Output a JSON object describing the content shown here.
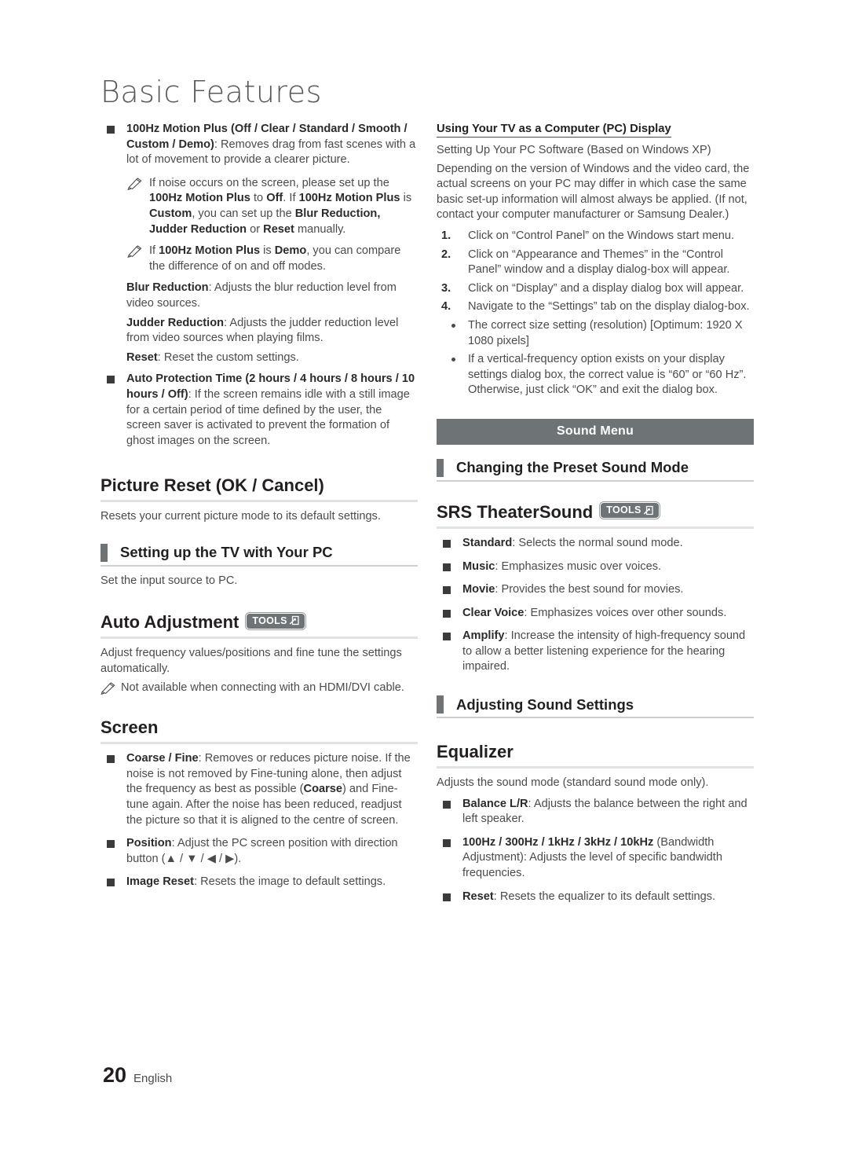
{
  "page": {
    "chapter_title": "Basic Features",
    "page_number": "20",
    "language": "English"
  },
  "icons": {
    "note": "pencil-note-icon",
    "tools": "tools-badge-icon",
    "bullet": "square-bullet-icon"
  },
  "colors": {
    "banner_bg": "#6e7375",
    "tab_marker": "#6e7375",
    "rule_main": "#e2e2e2",
    "rule_sub": "#cfcfcf",
    "body_text": "#4b4b4b",
    "heading_text": "#231f20"
  },
  "left_column": {
    "motion_plus_bullet": {
      "term": "100Hz Motion Plus (Off / Clear / Standard / Smooth / Custom / Demo)",
      "desc": ": Removes drag from fast scenes with a lot of movement to provide a clearer picture."
    },
    "notes": [
      {
        "parts": [
          {
            "t": "If noise occurs on the screen, please set up the ",
            "b": false
          },
          {
            "t": "100Hz Motion Plus",
            "b": true
          },
          {
            "t": " to ",
            "b": false
          },
          {
            "t": "Off",
            "b": true
          },
          {
            "t": ". If ",
            "b": false
          },
          {
            "t": "100Hz Motion Plus",
            "b": true
          },
          {
            "t": " is ",
            "b": false
          },
          {
            "t": "Custom",
            "b": true
          },
          {
            "t": ", you can set up the ",
            "b": false
          },
          {
            "t": "Blur Reduction, Judder Reduction",
            "b": true
          },
          {
            "t": " or ",
            "b": false
          },
          {
            "t": "Reset",
            "b": true
          },
          {
            "t": " manually.",
            "b": false
          }
        ]
      },
      {
        "parts": [
          {
            "t": "If ",
            "b": false
          },
          {
            "t": "100Hz Motion Plus",
            "b": true
          },
          {
            "t": " is ",
            "b": false
          },
          {
            "t": "Demo",
            "b": true
          },
          {
            "t": ", you can compare the difference of on and off modes.",
            "b": false
          }
        ]
      }
    ],
    "sub_paras": [
      {
        "term": "Blur Reduction",
        "desc": ": Adjusts the blur reduction level from video sources."
      },
      {
        "term": "Judder Reduction",
        "desc": ": Adjusts the judder reduction level from video sources when playing films."
      },
      {
        "term": "Reset",
        "desc": ": Reset the custom settings."
      }
    ],
    "auto_protection_bullet": {
      "term": "Auto Protection Time (2 hours / 4 hours / 8 hours / 10 hours / Off)",
      "desc": ": If the screen remains idle with a still image for a certain period of time defined by the user, the screen saver is activated to prevent the formation of ghost images on the screen."
    },
    "picture_reset": {
      "heading": "Picture Reset (OK / Cancel)",
      "body": "Resets your current picture mode to its default settings."
    },
    "setting_up_tv_pc": {
      "heading": "Setting up the TV with Your PC",
      "body": "Set the input source to PC."
    },
    "auto_adjustment": {
      "heading": "Auto Adjustment",
      "tools_label": "TOOLS",
      "body": "Adjust frequency values/positions and fine tune the settings automatically.",
      "note": "Not available when connecting with an HDMI/DVI cable."
    },
    "screen": {
      "heading": "Screen",
      "bullets": [
        {
          "parts": [
            {
              "t": "Coarse / Fine",
              "b": true
            },
            {
              "t": ": Removes or reduces picture noise. If the noise is not removed by Fine-tuning alone, then adjust the frequency as best as possible (",
              "b": false
            },
            {
              "t": "Coarse",
              "b": true
            },
            {
              "t": ") and Fine-tune again. After the noise has been reduced, readjust the picture so that it is aligned to the centre of screen.",
              "b": false
            }
          ]
        },
        {
          "parts": [
            {
              "t": "Position",
              "b": true
            },
            {
              "t": ": Adjust the PC screen position with direction button (▲ / ▼ / ◀ / ▶).",
              "b": false
            }
          ]
        },
        {
          "parts": [
            {
              "t": "Image Reset",
              "b": true
            },
            {
              "t": ": Resets the image to default settings.",
              "b": false
            }
          ]
        }
      ]
    }
  },
  "right_column": {
    "pc_display": {
      "heading": "Using Your TV as a Computer (PC) Display",
      "subtitle": "Setting Up Your PC Software (Based on Windows XP)",
      "intro": "Depending on the version of Windows and the video card, the actual screens on your PC may differ in which case the same basic set-up information will almost always be applied. (If not, contact your computer manufacturer or Samsung Dealer.)",
      "steps": [
        {
          "num": "1.",
          "text": "Click on “Control Panel” on the Windows start menu."
        },
        {
          "num": "2.",
          "text": "Click on “Appearance and Themes” in the “Control Panel” window and a display dialog-box will appear."
        },
        {
          "num": "3.",
          "text": "Click on “Display” and a display dialog box will appear."
        },
        {
          "num": "4.",
          "text": "Navigate to the “Settings” tab on the display dialog-box."
        }
      ],
      "dot_points": [
        "The correct size setting (resolution) [Optimum: 1920 X 1080 pixels]",
        "If a vertical-frequency option exists on your display settings dialog box, the correct value is “60” or “60 Hz”. Otherwise, just click “OK” and exit the dialog box."
      ]
    },
    "sound_menu_banner": "Sound Menu",
    "preset_sound_mode": {
      "heading": "Changing the Preset Sound Mode"
    },
    "srs_theatersound": {
      "heading": "SRS TheaterSound",
      "tools_label": "TOOLS",
      "bullets": [
        {
          "term": "Standard",
          "desc": ": Selects the normal sound mode."
        },
        {
          "term": "Music",
          "desc": ": Emphasizes music over voices."
        },
        {
          "term": "Movie",
          "desc": ": Provides the best sound for movies."
        },
        {
          "term": "Clear Voice",
          "desc": ": Emphasizes voices over other sounds."
        },
        {
          "term": "Amplify",
          "desc": ": Increase the intensity of high-frequency sound to allow a better listening experience for the hearing impaired."
        }
      ]
    },
    "adjusting_sound_settings": {
      "heading": "Adjusting Sound Settings"
    },
    "equalizer": {
      "heading": "Equalizer",
      "body": "Adjusts the sound mode (standard sound mode only).",
      "bullets": [
        {
          "term": "Balance L/R",
          "desc": ": Adjusts the balance between the right and left speaker."
        },
        {
          "term": "100Hz / 300Hz / 1kHz / 3kHz / 10kHz",
          "desc": " (Bandwidth Adjustment): Adjusts the level of specific bandwidth frequencies."
        },
        {
          "term": "Reset",
          "desc": ": Resets the equalizer to its default settings."
        }
      ]
    }
  }
}
